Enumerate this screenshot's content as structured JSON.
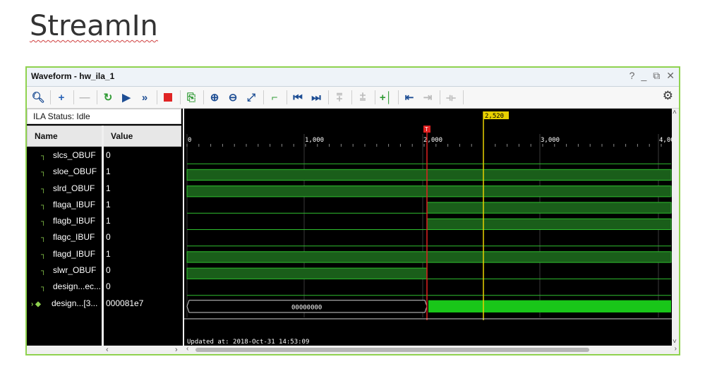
{
  "slide_title": "StreamIn",
  "window": {
    "title": "Waveform - hw_ila_1",
    "controls": [
      "?",
      "_",
      "⧉",
      "✕"
    ]
  },
  "toolbar": {
    "icons": [
      "search-icon",
      "zoom-in-add-icon",
      "remove-icon",
      "refresh-icon",
      "run-icon",
      "fast-forward-icon",
      "stop-icon",
      "export-icon",
      "zoom-in-icon",
      "zoom-out-icon",
      "zoom-fit-icon",
      "marker-icon",
      "go-start-icon",
      "go-end-icon",
      "prev-transition-icon",
      "next-transition-icon",
      "add-marker-icon",
      "prev-marker-icon",
      "next-marker-icon",
      "swap-cursors-icon",
      "settings-icon"
    ]
  },
  "status": "ILA Status: Idle",
  "columns": {
    "name": "Name",
    "value": "Value"
  },
  "signals": [
    {
      "name": "slcs_OBUF",
      "value": "0"
    },
    {
      "name": "sloe_OBUF",
      "value": "1"
    },
    {
      "name": "slrd_OBUF",
      "value": "1"
    },
    {
      "name": "flaga_IBUF",
      "value": "1"
    },
    {
      "name": "flagb_IBUF",
      "value": "1"
    },
    {
      "name": "flagc_IBUF",
      "value": "0"
    },
    {
      "name": "flagd_IBUF",
      "value": "1"
    },
    {
      "name": "slwr_OBUF",
      "value": "0"
    },
    {
      "name": "design...ec...",
      "value": "0"
    },
    {
      "name": "design...[3...",
      "value": "000081e7"
    }
  ],
  "timeline": {
    "ticks": [
      "0",
      "1,000",
      "2,000",
      "3,000",
      "4,00"
    ],
    "trigger_marker": "T",
    "cursor_label": "2,520",
    "bus_value": "00000000"
  },
  "updated_text": "Updated at: 2018-Oct-31 14:53:09",
  "colors": {
    "wave_green": "#1a5e1a",
    "bus_green": "#19c619",
    "trigger": "#e02020",
    "cursor": "#e8d100",
    "border": "#8fd24f"
  }
}
